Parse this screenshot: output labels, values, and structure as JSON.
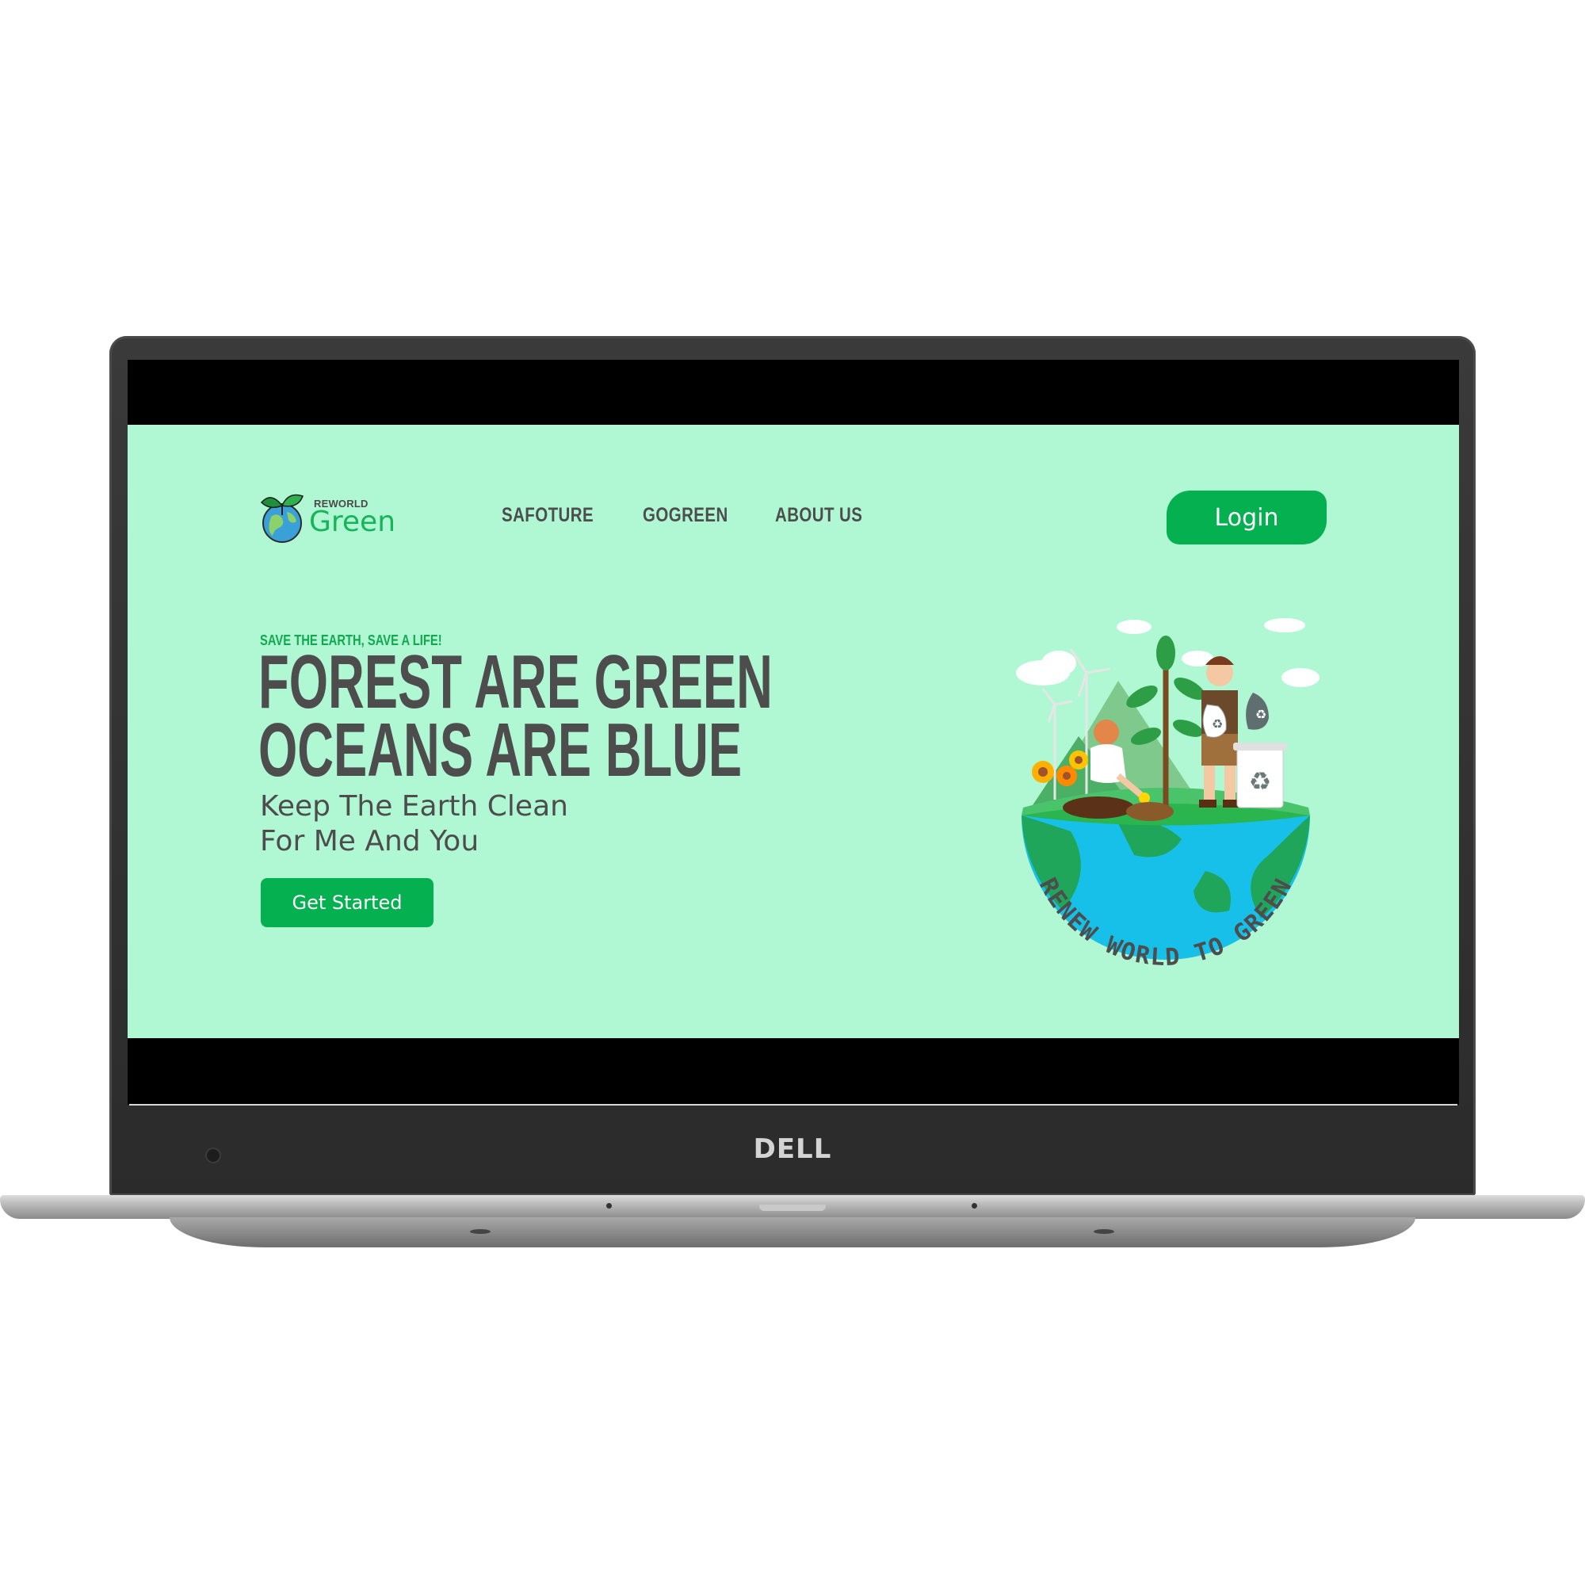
{
  "device": {
    "brand": "DELL"
  },
  "site": {
    "logo": {
      "small": "REWORLD",
      "big": "Green"
    },
    "nav": [
      "SAFOTURE",
      "GOGREEN",
      "ABOUT US"
    ],
    "login_label": "Login",
    "hero": {
      "tagline": "SAVE THE EARTH, SAVE A LIFE!",
      "headline_line1": "FOREST ARE GREEN",
      "headline_line2": "OCEANS ARE BLUE",
      "sub_line1": "Keep The Earth Clean",
      "sub_line2": "For Me And You",
      "cta_label": "Get Started"
    },
    "illustration": {
      "ring_text": "RENEW WORLD TO GREEN"
    }
  },
  "colors": {
    "page_bg": "#b0f8d3",
    "accent": "#05b050",
    "text_dark": "#4d4d4d"
  }
}
